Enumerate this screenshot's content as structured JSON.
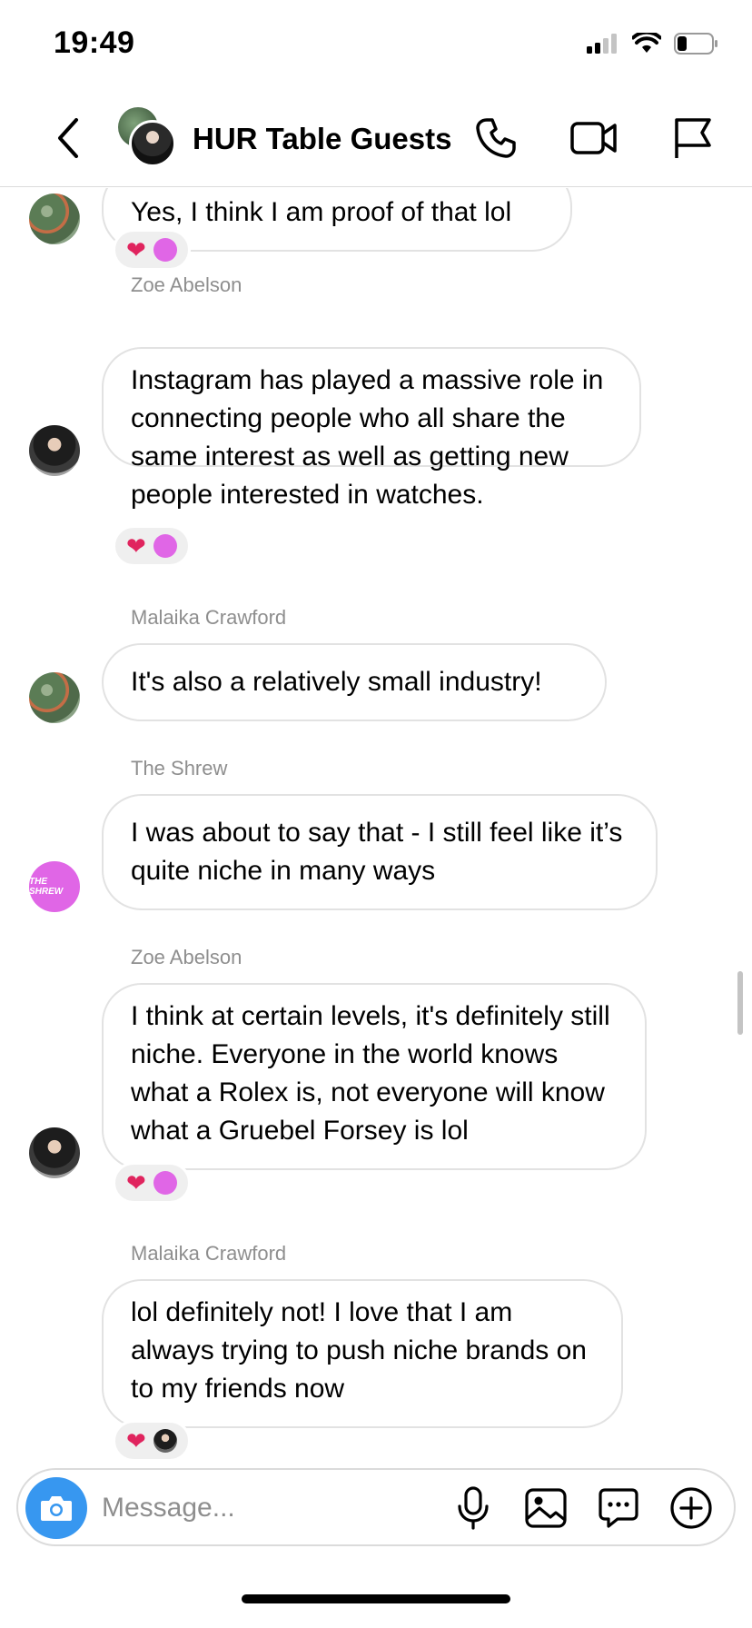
{
  "status_bar": {
    "time": "19:49"
  },
  "header": {
    "title": "HUR Table Guests",
    "back_icon": "chevron-left-icon",
    "actions": [
      "phone-icon",
      "video-icon",
      "flag-icon"
    ]
  },
  "messages": [
    {
      "sender": "",
      "text": "Yes, I think I am proof of that lol",
      "avatar": "malaika",
      "reactions": [
        "heart",
        "shrew"
      ]
    },
    {
      "sender": "Zoe Abelson",
      "text": "Instagram has played a massive role in connecting people who all share the same interest as well as getting new people interested in watches.",
      "avatar": "zoe",
      "reactions": [
        "heart",
        "shrew"
      ]
    },
    {
      "sender": "Malaika Crawford",
      "text": "It's also a relatively small industry!",
      "avatar": "malaika",
      "reactions": []
    },
    {
      "sender": "The Shrew",
      "text": "I was about to say that - I still feel like it’s quite niche in many ways",
      "avatar": "shrew",
      "reactions": []
    },
    {
      "sender": "Zoe Abelson",
      "text": "I think at certain levels, it's definitely still niche. Everyone in the world knows what a Rolex is, not everyone will know what a Gruebel Forsey is lol",
      "avatar": "zoe",
      "reactions": [
        "heart",
        "shrew"
      ]
    },
    {
      "sender": "Malaika Crawford",
      "text": "lol definitely not! I love that I am always trying to push niche brands on to my friends now",
      "avatar": "",
      "reactions": [
        "heart",
        "zoe"
      ]
    }
  ],
  "composer": {
    "placeholder": "Message...",
    "actions": [
      "microphone-icon",
      "image-icon",
      "sticker-icon",
      "add-icon"
    ]
  },
  "colors": {
    "accent": "#3797f0",
    "heart": "#e0245e",
    "shrew_brand": "#e066e6"
  }
}
